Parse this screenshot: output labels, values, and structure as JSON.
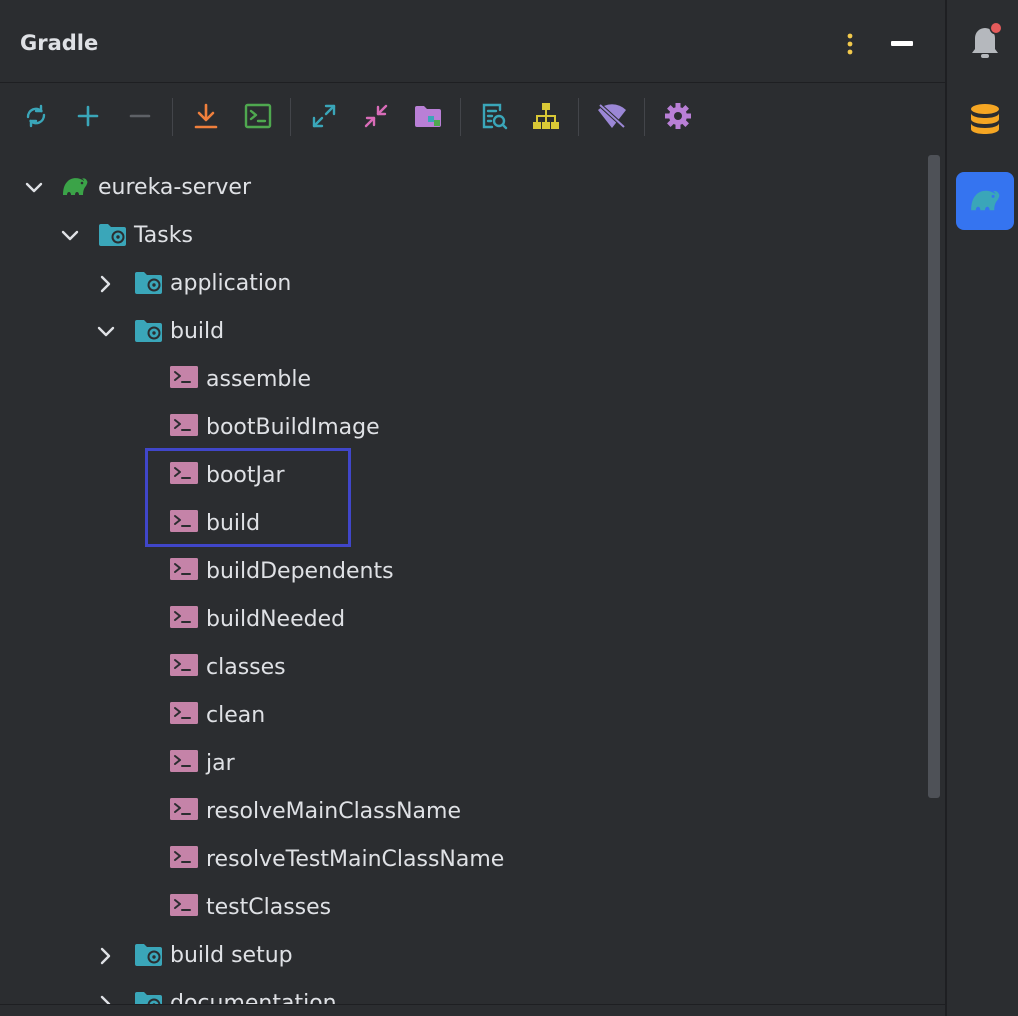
{
  "panel": {
    "title": "Gradle",
    "header_buttons": [
      {
        "name": "options-icon",
        "color": "#f2c94c"
      },
      {
        "name": "hide-icon",
        "color": "#ffffff"
      }
    ]
  },
  "toolbar": {
    "buttons": [
      {
        "name": "reload-icon",
        "color": "#3aa6b9"
      },
      {
        "name": "add-icon",
        "color": "#3aa6b9"
      },
      {
        "name": "remove-icon",
        "color": "#5e6166"
      },
      {
        "name": "download-sources-icon",
        "color": "#f07f3c"
      },
      {
        "name": "execute-task-icon",
        "color": "#4fa84f"
      },
      {
        "name": "expand-all-icon",
        "color": "#3aa6b9"
      },
      {
        "name": "collapse-all-icon",
        "color": "#d96cb8"
      },
      {
        "name": "group-modules-icon",
        "color": "#b97fd6"
      },
      {
        "name": "analyze-dependencies-icon",
        "color": "#3aa6b9"
      },
      {
        "name": "dependencies-diagram-icon",
        "color": "#d9c836"
      },
      {
        "name": "offline-mode-icon",
        "color": "#9b87d6"
      },
      {
        "name": "build-settings-icon",
        "color": "#b97fd6"
      }
    ]
  },
  "tree": {
    "root": {
      "label": "eureka-server",
      "expanded": true
    },
    "tasks": {
      "label": "Tasks",
      "expanded": true
    },
    "groups": [
      {
        "label": "application",
        "expanded": false
      },
      {
        "label": "build",
        "expanded": true
      },
      {
        "label": "build setup",
        "expanded": false
      },
      {
        "label": "documentation",
        "expanded": false
      }
    ],
    "build_tasks": [
      "assemble",
      "bootBuildImage",
      "bootJar",
      "build",
      "buildDependents",
      "buildNeeded",
      "classes",
      "clean",
      "jar",
      "resolveMainClassName",
      "resolveTestMainClassName",
      "testClasses"
    ]
  },
  "right_strip": [
    {
      "name": "notifications-icon",
      "badge_color": "#e55b5b"
    },
    {
      "name": "database-icon",
      "color": "#f5a623"
    },
    {
      "name": "gradle-icon",
      "active": true
    }
  ],
  "colors": {
    "background": "#2b2d30",
    "text": "#dfe1e5",
    "folder": "#3aa6b9",
    "task_icon": "#c583a8",
    "gradle_green": "#3ba348",
    "highlight": "#4046c9",
    "active_tab": "#3574f0"
  }
}
